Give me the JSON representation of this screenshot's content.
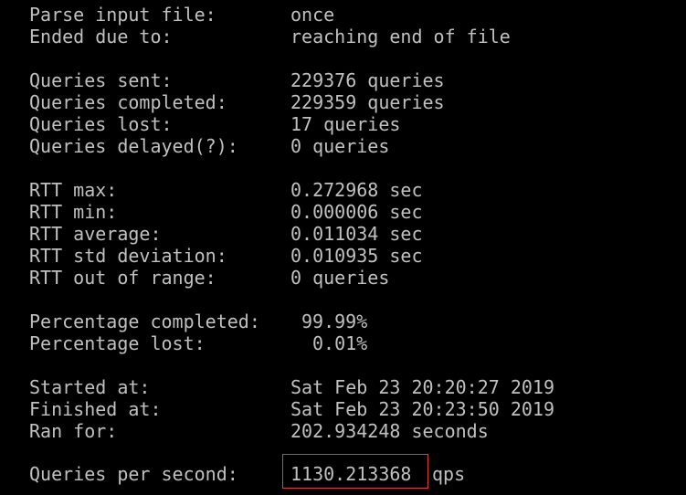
{
  "colors": {
    "background": "#000000",
    "text": "#c0c0c0",
    "highlight_border": "#e53935"
  },
  "rows": {
    "parse_input": {
      "label": "Parse input file:",
      "value": "once"
    },
    "ended_due": {
      "label": "Ended due to:",
      "value": "reaching end of file"
    },
    "queries_sent": {
      "label": "Queries sent:",
      "value": "229376 queries"
    },
    "queries_completed": {
      "label": "Queries completed:",
      "value": "229359 queries"
    },
    "queries_lost": {
      "label": "Queries lost:",
      "value": "17 queries"
    },
    "queries_delayed": {
      "label": "Queries delayed(?):",
      "value": "0 queries"
    },
    "rtt_max": {
      "label": "RTT max:",
      "value": "0.272968 sec"
    },
    "rtt_min": {
      "label": "RTT min:",
      "value": "0.000006 sec"
    },
    "rtt_average": {
      "label": "RTT average:",
      "value": "0.011034 sec"
    },
    "rtt_std": {
      "label": "RTT std deviation:",
      "value": "0.010935 sec"
    },
    "rtt_out": {
      "label": "RTT out of range:",
      "value": "0 queries"
    },
    "pct_completed": {
      "label": "Percentage completed:",
      "value": "99.99%"
    },
    "pct_lost": {
      "label": "Percentage lost:",
      "value": "0.01%"
    },
    "started": {
      "label": "Started at:",
      "value": "Sat Feb 23 20:20:27 2019"
    },
    "finished": {
      "label": "Finished at:",
      "value": "Sat Feb 23 20:23:50 2019"
    },
    "ran_for": {
      "label": "Ran for:",
      "value": "202.934248 seconds"
    },
    "qps": {
      "label": "Queries per second:",
      "value": "1130.213368",
      "unit": "qps"
    }
  }
}
